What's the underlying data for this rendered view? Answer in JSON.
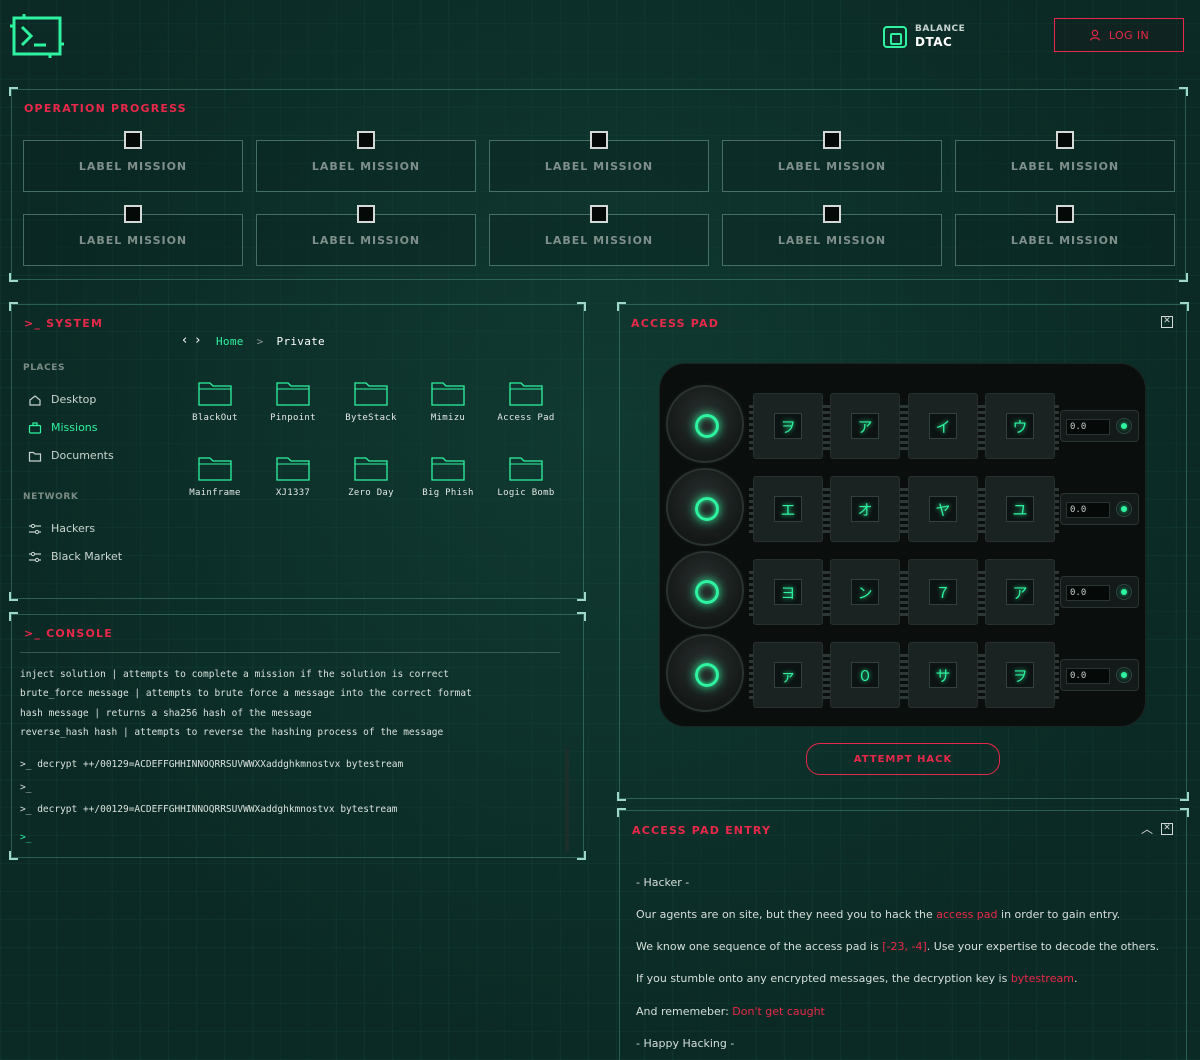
{
  "header": {
    "balance_label": "BALANCE",
    "balance_value": "DTAC",
    "login_label": "LOG IN"
  },
  "progress": {
    "title": "OPERATION PROGRESS",
    "missions": [
      {
        "label": "LABEL MISSION",
        "checked": false
      },
      {
        "label": "LABEL MISSION",
        "checked": false
      },
      {
        "label": "LABEL MISSION",
        "checked": false
      },
      {
        "label": "LABEL MISSION",
        "checked": false
      },
      {
        "label": "LABEL MISSION",
        "checked": false
      },
      {
        "label": "LABEL MISSION",
        "checked": false
      },
      {
        "label": "LABEL MISSION",
        "checked": false
      },
      {
        "label": "LABEL MISSION",
        "checked": false
      },
      {
        "label": "LABEL MISSION",
        "checked": false
      },
      {
        "label": "LABEL MISSION",
        "checked": false
      }
    ]
  },
  "system": {
    "title": ">_ SYSTEM",
    "places_heading": "PLACES",
    "places": [
      {
        "label": "Desktop",
        "icon": "desktop-icon"
      },
      {
        "label": "Missions",
        "icon": "briefcase-icon",
        "active": true
      },
      {
        "label": "Documents",
        "icon": "folder-icon"
      }
    ],
    "network_heading": "NETWORK",
    "network": [
      {
        "label": "Hackers",
        "icon": "sliders-icon"
      },
      {
        "label": "Black Market",
        "icon": "sliders-icon"
      }
    ],
    "breadcrumb": {
      "home": "Home",
      "separator": ">",
      "current": "Private"
    },
    "folders": [
      "BlackOut",
      "Pinpoint",
      "ByteStack",
      "Mimizu",
      "Access Pad",
      "Mainframe",
      "XJ1337",
      "Zero Day",
      "Big Phish",
      "Logic Bomb"
    ]
  },
  "console": {
    "title": ">_ CONSOLE",
    "help_lines": [
      "inject solution | attempts to complete a mission if the solution is correct",
      "brute_force message | attempts to brute force a message into the correct format",
      "hash message | returns a sha256 hash of the message",
      "reverse_hash hash | attempts to reverse the hashing process of the message"
    ],
    "history": [
      {
        "prompt": ">_",
        "command": "decrypt ++/00129=ACDEFFGHHINNOQRRSUVWWXXaddghkmnostvx bytestream"
      },
      {
        "prompt": ">_",
        "command": ""
      },
      {
        "prompt": ">_",
        "command": "decrypt ++/00129=ACDEFFGHHINNOQRRSUVWWXaddghkmnostvx bytestream"
      }
    ],
    "input_prompt": ">_"
  },
  "access_pad": {
    "title": "ACCESS PAD",
    "rows": [
      {
        "keys": [
          "ヲ",
          "ア",
          "イ",
          "ウ"
        ],
        "value": "0.0"
      },
      {
        "keys": [
          "エ",
          "オ",
          "ヤ",
          "ユ"
        ],
        "value": "0.0"
      },
      {
        "keys": [
          "ヨ",
          "ン",
          "７",
          "ア"
        ],
        "value": "0.0"
      },
      {
        "keys": [
          "ァ",
          "０",
          "サ",
          "ヲ"
        ],
        "value": "0.0"
      }
    ],
    "attempt_label": "ATTEMPT HACK"
  },
  "entry": {
    "title": "ACCESS PAD ENTRY",
    "from": "- Hacker -",
    "p1_pre": "Our agents are on site, but they need you to hack the ",
    "p1_hl": "access pad",
    "p1_post": " in order to gain entry.",
    "p2_pre": "We know one sequence of the access pad is ",
    "p2_hl": "[-23, -4]",
    "p2_post": ". Use your expertise to decode the others.",
    "p3_pre": "If you stumble onto any encrypted messages, the decryption key is ",
    "p3_hl": "bytestream",
    "p3_post": ".",
    "p4_pre": "And rememeber: ",
    "p4_hl": "Don't get caught",
    "sign": "- Happy Hacking -"
  },
  "colors": {
    "accent_green": "#2ef3a0",
    "accent_red": "#e8284a",
    "bg": "#0b2a25"
  }
}
